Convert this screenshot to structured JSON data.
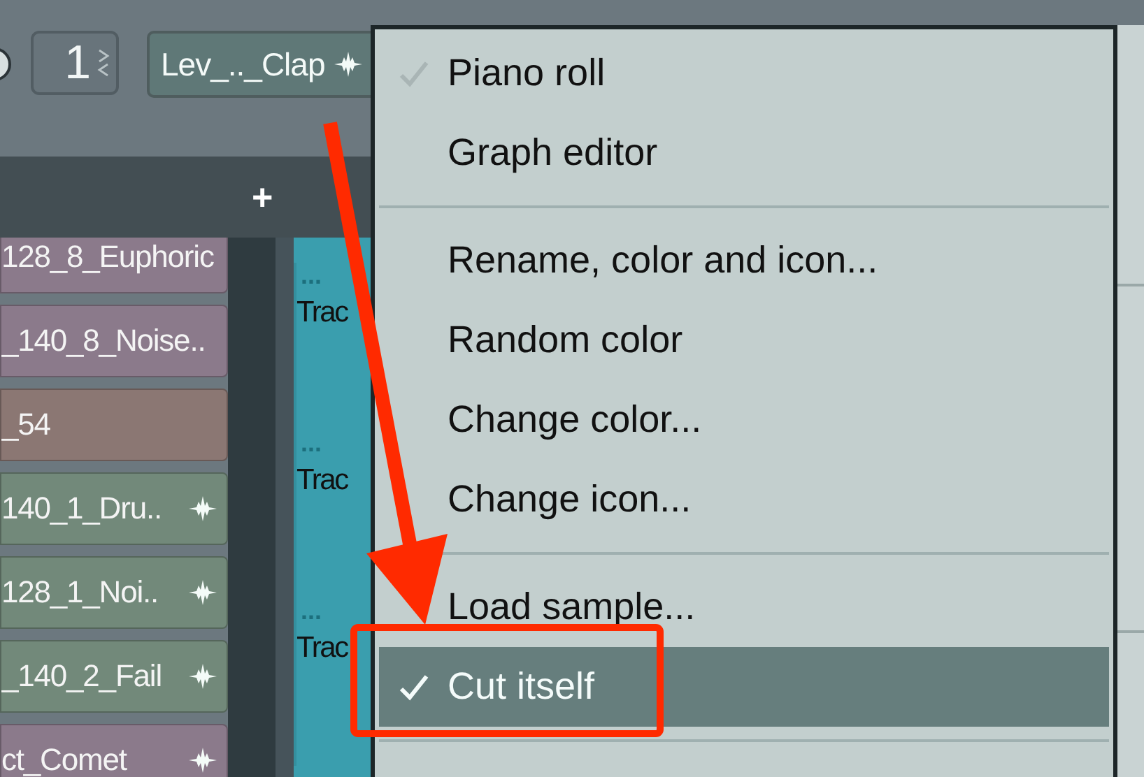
{
  "toolbar": {
    "spin_value": "1",
    "pattern_button": {
      "label": "Lev_.._Clap"
    }
  },
  "tab_bar": {
    "add_button": "+"
  },
  "channels": [
    {
      "name": "128_8_Euphoric",
      "color": "#8b7a8b",
      "kind": "plain"
    },
    {
      "name": "_140_8_Noise..",
      "color": "#8b7a8b",
      "kind": "plain"
    },
    {
      "name": "_54",
      "color": "#8b7773",
      "kind": "plain"
    },
    {
      "name": "140_1_Dru..",
      "color": "#72897a",
      "kind": "clip"
    },
    {
      "name": "128_1_Noi..",
      "color": "#72897a",
      "kind": "clip"
    },
    {
      "name": "_140_2_Fail",
      "color": "#72897a",
      "kind": "clip"
    },
    {
      "name": "ct_Comet",
      "color": "#8b7a8b",
      "kind": "clip"
    }
  ],
  "tracks": [
    {
      "dots": "...",
      "label": "Trac"
    },
    {
      "dots": "...",
      "label": "Trac"
    },
    {
      "dots": "...",
      "label": "Trac"
    }
  ],
  "context_menu": {
    "items": [
      {
        "kind": "item",
        "label": "Piano roll",
        "checked": true,
        "selected": false
      },
      {
        "kind": "item",
        "label": "Graph editor",
        "checked": false,
        "selected": false
      },
      {
        "kind": "separator"
      },
      {
        "kind": "item",
        "label": "Rename, color and icon...",
        "checked": false,
        "selected": false
      },
      {
        "kind": "item",
        "label": "Random color",
        "checked": false,
        "selected": false
      },
      {
        "kind": "item",
        "label": "Change color...",
        "checked": false,
        "selected": false
      },
      {
        "kind": "item",
        "label": "Change icon...",
        "checked": false,
        "selected": false
      },
      {
        "kind": "separator"
      },
      {
        "kind": "item",
        "label": "Load sample...",
        "checked": false,
        "selected": false
      },
      {
        "kind": "item",
        "label": "Cut itself",
        "checked": true,
        "selected": true
      },
      {
        "kind": "separator"
      }
    ]
  }
}
